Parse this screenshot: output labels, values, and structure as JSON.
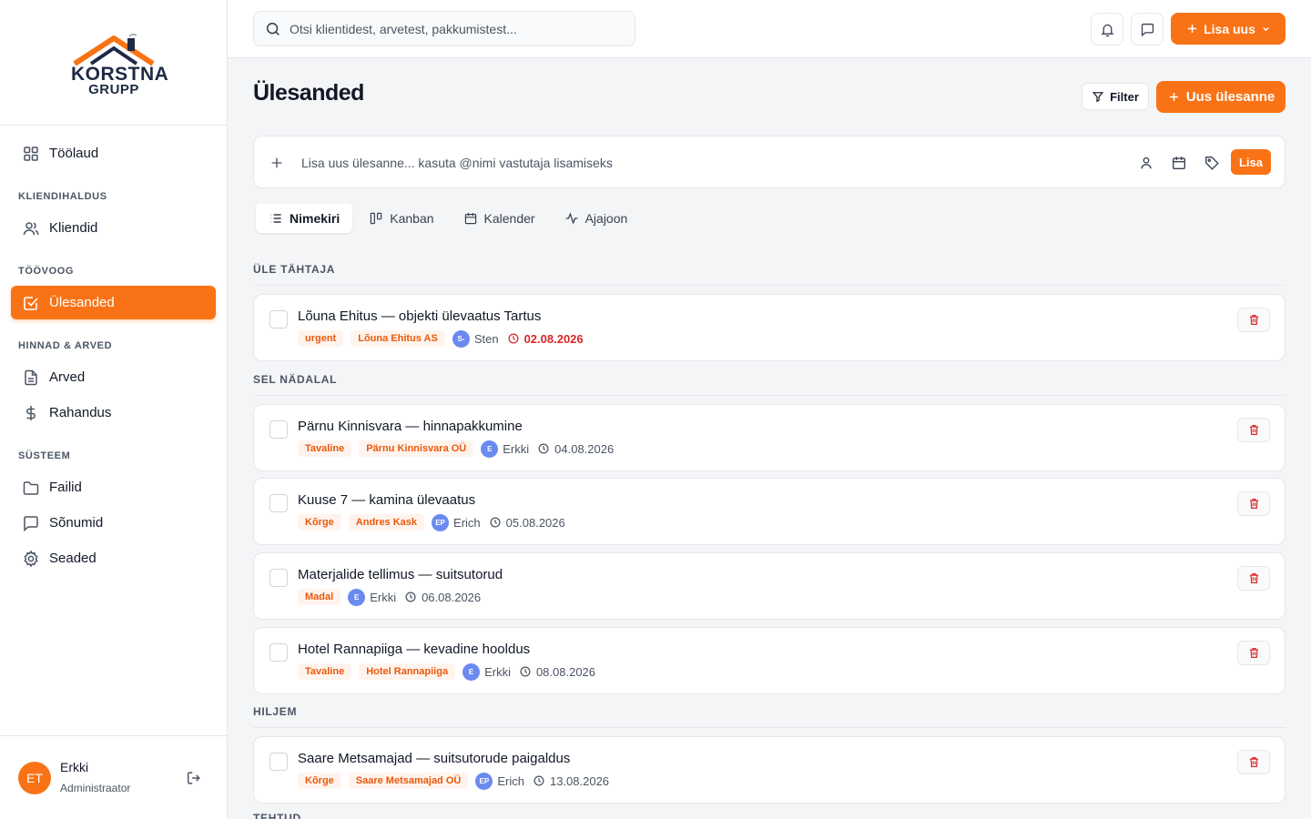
{
  "brand": {
    "line1": "KORSTNA",
    "line2": "GRUPP"
  },
  "sidebar": {
    "items": [
      {
        "label": "Töölaud"
      },
      {
        "section": "KLIENDIHALDUS"
      },
      {
        "label": "Kliendid"
      },
      {
        "section": "TÖÖVOOG"
      },
      {
        "label": "Ülesanded",
        "active": true
      },
      {
        "section": "HINNAD & ARVED"
      },
      {
        "label": "Arved"
      },
      {
        "label": "Rahandus"
      },
      {
        "section": "SÜSTEEM"
      },
      {
        "label": "Failid"
      },
      {
        "label": "Sõnumid"
      },
      {
        "label": "Seaded"
      }
    ]
  },
  "user": {
    "initials": "ET",
    "name": "Erkki",
    "role": "Administraator"
  },
  "topbar": {
    "search_placeholder": "Otsi klientidest, arvetest, pakkumistest...",
    "add_new_label": "Lisa uus"
  },
  "page": {
    "title": "Ülesanded",
    "filter_label": "Filter",
    "new_task_label": "Uus ülesanne"
  },
  "quick_add": {
    "placeholder": "Lisa uus ülesanne... kasuta @nimi vastutaja lisamiseks",
    "submit_label": "Lisa"
  },
  "tabs": [
    {
      "label": "Nimekiri",
      "active": true
    },
    {
      "label": "Kanban"
    },
    {
      "label": "Kalender"
    },
    {
      "label": "Ajajoon"
    }
  ],
  "groups": [
    {
      "label": "ÜLE TÄHTAJA",
      "tasks": [
        {
          "title": "Lõuna Ehitus — objekti ülevaatus Tartus",
          "tags": [
            "urgent",
            "Lõuna Ehitus AS"
          ],
          "assignee_initials": "S-",
          "assignee": "Sten",
          "due": "02.08.2026",
          "overdue": true
        }
      ]
    },
    {
      "label": "SEL NÄDALAL",
      "tasks": [
        {
          "title": "Pärnu Kinnisvara — hinnapakkumine",
          "tags": [
            "Tavaline",
            "Pärnu Kinnisvara OÜ"
          ],
          "assignee_initials": "E",
          "assignee": "Erkki",
          "due": "04.08.2026"
        },
        {
          "title": "Kuuse 7 — kamina ülevaatus",
          "tags": [
            "Kõrge",
            "Andres Kask"
          ],
          "assignee_initials": "EP",
          "assignee": "Erich",
          "due": "05.08.2026"
        },
        {
          "title": "Materjalide tellimus — suitsutorud",
          "tags": [
            "Madal"
          ],
          "assignee_initials": "E",
          "assignee": "Erkki",
          "due": "06.08.2026"
        },
        {
          "title": "Hotel Rannapiiga — kevadine hooldus",
          "tags": [
            "Tavaline",
            "Hotel Rannapiiga"
          ],
          "assignee_initials": "E",
          "assignee": "Erkki",
          "due": "08.08.2026"
        }
      ]
    },
    {
      "label": "HILJEM",
      "tasks": [
        {
          "title": "Saare Metsamajad — suitsutorude paigaldus",
          "tags": [
            "Kõrge",
            "Saare Metsamajad OÜ"
          ],
          "assignee_initials": "EP",
          "assignee": "Erich",
          "due": "13.08.2026"
        }
      ]
    },
    {
      "label": "TEHTUD"
    }
  ],
  "colors": {
    "accent": "#f97316",
    "danger": "#dc2626",
    "avatar": "#6b8af0"
  },
  "icons": [
    "logo-house-icon",
    "grid-icon",
    "users-icon",
    "check-square-icon",
    "file-icon",
    "dollar-icon",
    "folder-icon",
    "message-icon",
    "gear-icon",
    "logout-icon",
    "search-icon",
    "bell-icon",
    "chat-icon",
    "plus-icon",
    "chevron-down-icon",
    "filter-icon",
    "person-icon",
    "calendar-icon",
    "tag-icon",
    "list-icon",
    "kanban-icon",
    "activity-icon",
    "clock-icon",
    "trash-icon"
  ]
}
